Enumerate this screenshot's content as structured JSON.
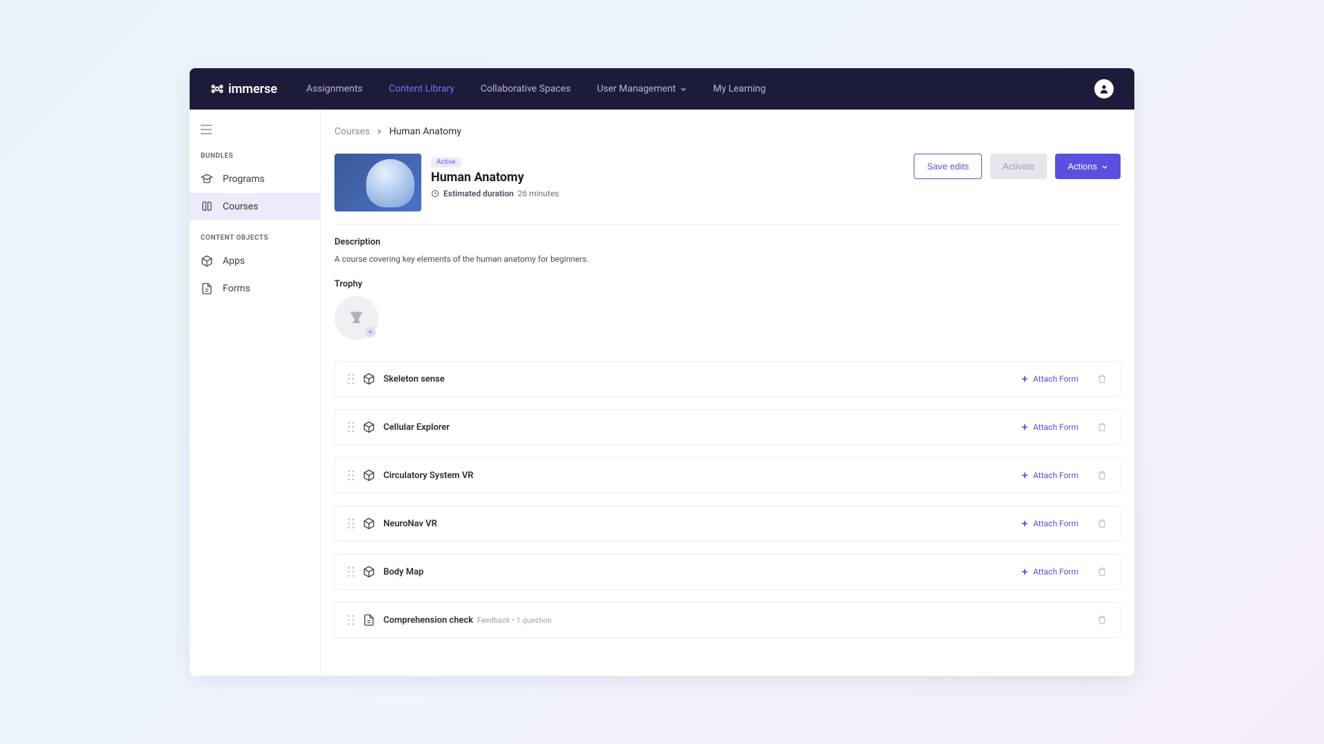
{
  "brand": "immerse",
  "nav": {
    "items": [
      {
        "label": "Assignments"
      },
      {
        "label": "Content Library",
        "active": true
      },
      {
        "label": "Collaborative Spaces"
      },
      {
        "label": "User Management",
        "dropdown": true
      },
      {
        "label": "My Learning"
      }
    ]
  },
  "sidebar": {
    "sections": [
      {
        "heading": "BUNDLES",
        "items": [
          {
            "label": "Programs",
            "icon": "graduation"
          },
          {
            "label": "Courses",
            "icon": "book",
            "active": true
          }
        ]
      },
      {
        "heading": "CONTENT OBJECTS",
        "items": [
          {
            "label": "Apps",
            "icon": "cube"
          },
          {
            "label": "Forms",
            "icon": "document"
          }
        ]
      }
    ]
  },
  "breadcrumb": {
    "root": "Courses",
    "current": "Human Anatomy"
  },
  "course": {
    "status": "Active",
    "title": "Human Anatomy",
    "duration_label": "Estimated duration",
    "duration_value": "26 minutes"
  },
  "actions": {
    "save": "Save edits",
    "activate": "Activate",
    "actions": "Actions"
  },
  "details": {
    "description_heading": "Description",
    "description_text": "A course covering key elements of the human anatomy for beginners.",
    "trophy_heading": "Trophy"
  },
  "attach_form_label": "Attach Form",
  "content_items": [
    {
      "title": "Skeleton sense",
      "icon": "cube",
      "attach": true
    },
    {
      "title": "Cellular Explorer",
      "icon": "cube",
      "attach": true
    },
    {
      "title": "Circulatory System VR",
      "icon": "cube",
      "attach": true
    },
    {
      "title": "NeuroNav VR",
      "icon": "cube",
      "attach": true
    },
    {
      "title": "Body Map",
      "icon": "cube",
      "attach": true
    },
    {
      "title": "Comprehension check",
      "icon": "document",
      "subtitle": "Feedback • 1 question",
      "attach": false
    }
  ]
}
